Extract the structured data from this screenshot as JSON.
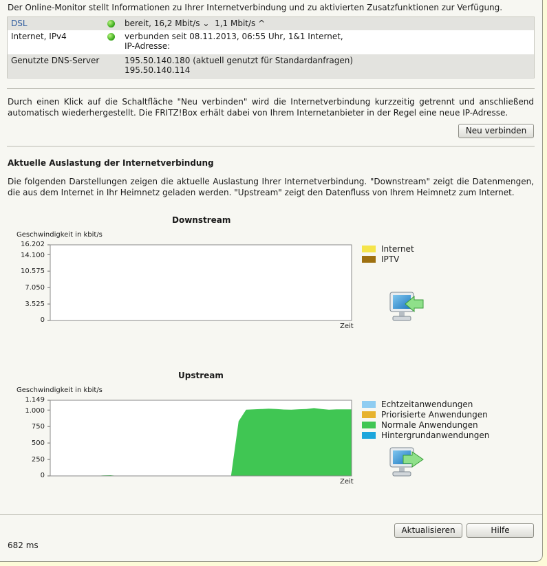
{
  "intro": "Der Online-Monitor stellt Informationen zu Ihrer Internetverbindung und zu aktivierten Zusatzfunktionen zur Verfügung.",
  "status": {
    "dsl": {
      "label": "DSL",
      "value": "bereit, 16,2 Mbit/s",
      "down_arrow": "⌄",
      "up_value": "1,1 Mbit/s",
      "up_arrow": "^"
    },
    "ipv4": {
      "label": "Internet, IPv4",
      "line1": "verbunden seit 08.11.2013, 06:55 Uhr, 1&1 Internet,",
      "line2": "IP-Adresse:"
    },
    "dns": {
      "label": "Genutzte DNS-Server",
      "line1": "195.50.140.180 (aktuell genutzt für Standardanfragen)",
      "line2": "195.50.140.114"
    }
  },
  "reconnect_text": "Durch einen Klick auf die Schaltfläche \"Neu verbinden\" wird die Internetverbindung kurzzeitig getrennt und anschließend automatisch wiederhergestellt. Die FRITZ!Box erhält dabei von Ihrem Internetanbieter in der Regel eine neue IP-Adresse.",
  "reconnect_button": "Neu verbinden",
  "load_heading": "Aktuelle Auslastung der Internetverbindung",
  "load_text": "Die folgenden Darstellungen zeigen die aktuelle Auslastung Ihrer Internetverbindung. \"Downstream\" zeigt die Datenmengen, die aus dem Internet in Ihr Heimnetz geladen werden. \"Upstream\" zeigt den Datenfluss von Ihrem Heimnetz zum Internet.",
  "downstream": {
    "title": "Downstream",
    "ylabel": "Geschwindigkeit in kbit/s",
    "xlabel": "Zeit",
    "ticks": [
      "16.202",
      "14.100",
      "10.575",
      "7.050",
      "3.525",
      "0"
    ],
    "legend": [
      {
        "label": "Internet",
        "color": "#f5e44a"
      },
      {
        "label": "IPTV",
        "color": "#9e7010"
      }
    ],
    "icon": "computer-download-icon"
  },
  "upstream": {
    "title": "Upstream",
    "ylabel": "Geschwindigkeit in kbit/s",
    "xlabel": "Zeit",
    "ticks": [
      "1.149",
      "1.000",
      "750",
      "500",
      "250",
      "0"
    ],
    "legend": [
      {
        "label": "Echtzeitanwendungen",
        "color": "#8fcdf2"
      },
      {
        "label": "Priorisierte Anwendungen",
        "color": "#e7b32e"
      },
      {
        "label": "Normale Anwendungen",
        "color": "#40c653"
      },
      {
        "label": "Hintergrundanwendungen",
        "color": "#1da6dc"
      }
    ],
    "icon": "computer-upload-icon"
  },
  "chart_data": [
    {
      "type": "area",
      "title": "Downstream",
      "ylabel": "Geschwindigkeit in kbit/s",
      "xlabel": "Zeit",
      "ylim": [
        0,
        16202
      ],
      "series": [
        {
          "name": "Internet",
          "color": "#f5e44a",
          "values": [
            0,
            0,
            0,
            0,
            0,
            0,
            0,
            0,
            0,
            0,
            0,
            0,
            0,
            0,
            0,
            0,
            0,
            0,
            0,
            0
          ]
        },
        {
          "name": "IPTV",
          "color": "#9e7010",
          "values": [
            0,
            0,
            0,
            0,
            0,
            0,
            0,
            0,
            0,
            0,
            0,
            0,
            0,
            0,
            0,
            0,
            0,
            0,
            0,
            0
          ]
        }
      ]
    },
    {
      "type": "area",
      "title": "Upstream",
      "ylabel": "Geschwindigkeit in kbit/s",
      "xlabel": "Zeit",
      "ylim": [
        0,
        1149
      ],
      "series": [
        {
          "name": "Normale Anwendungen",
          "color": "#40c653",
          "values": [
            0,
            0,
            0,
            0,
            0,
            0,
            0,
            8,
            10,
            0,
            0,
            0,
            0,
            0,
            0,
            0,
            0,
            0,
            0,
            0,
            0,
            0,
            0,
            0,
            0,
            830,
            1005,
            1010,
            1015,
            1020,
            1015,
            1008,
            1005,
            1012,
            1015,
            1030,
            1015,
            1005,
            1010,
            1010,
            1010
          ]
        }
      ]
    }
  ],
  "footer": {
    "update_button": "Aktualisieren",
    "help_button": "Hilfe",
    "timing": "682 ms"
  }
}
